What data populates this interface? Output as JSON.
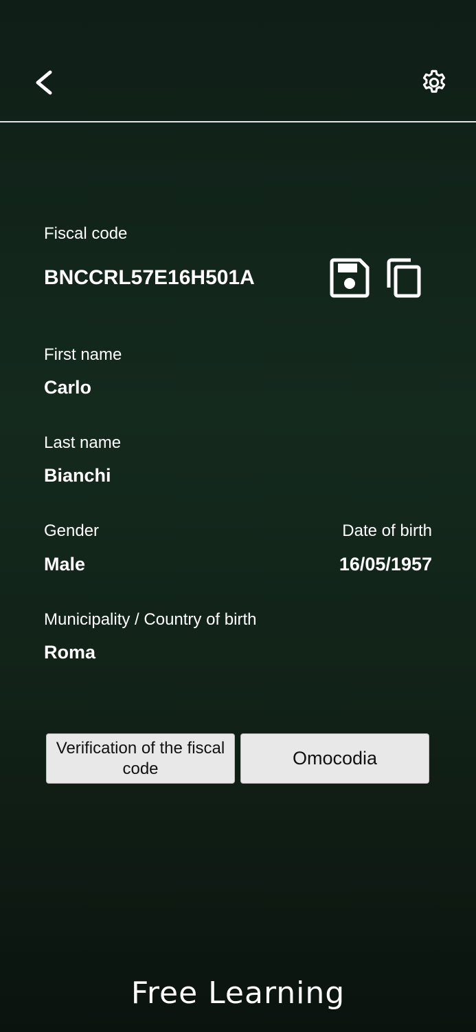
{
  "header": {
    "back_icon": "chevron-left-icon",
    "settings_icon": "gear-icon"
  },
  "fiscal_code": {
    "label": "Fiscal code",
    "value": "BNCCRL57E16H501A",
    "save_icon": "floppy-disk-icon",
    "copy_icon": "copy-icon"
  },
  "first_name": {
    "label": "First name",
    "value": "Carlo"
  },
  "last_name": {
    "label": "Last name",
    "value": "Bianchi"
  },
  "gender": {
    "label": "Gender",
    "value": "Male"
  },
  "date_of_birth": {
    "label": "Date of birth",
    "value": "16/05/1957"
  },
  "birthplace": {
    "label": "Municipality / Country of birth",
    "value": "Roma"
  },
  "buttons": {
    "verify": "Verification of the fiscal code",
    "omocodia": "Omocodia"
  },
  "footer": {
    "brand": "Free Learning"
  },
  "colors": {
    "background": "#132419",
    "button_bg": "#e8e8e8",
    "text": "#ffffff"
  }
}
